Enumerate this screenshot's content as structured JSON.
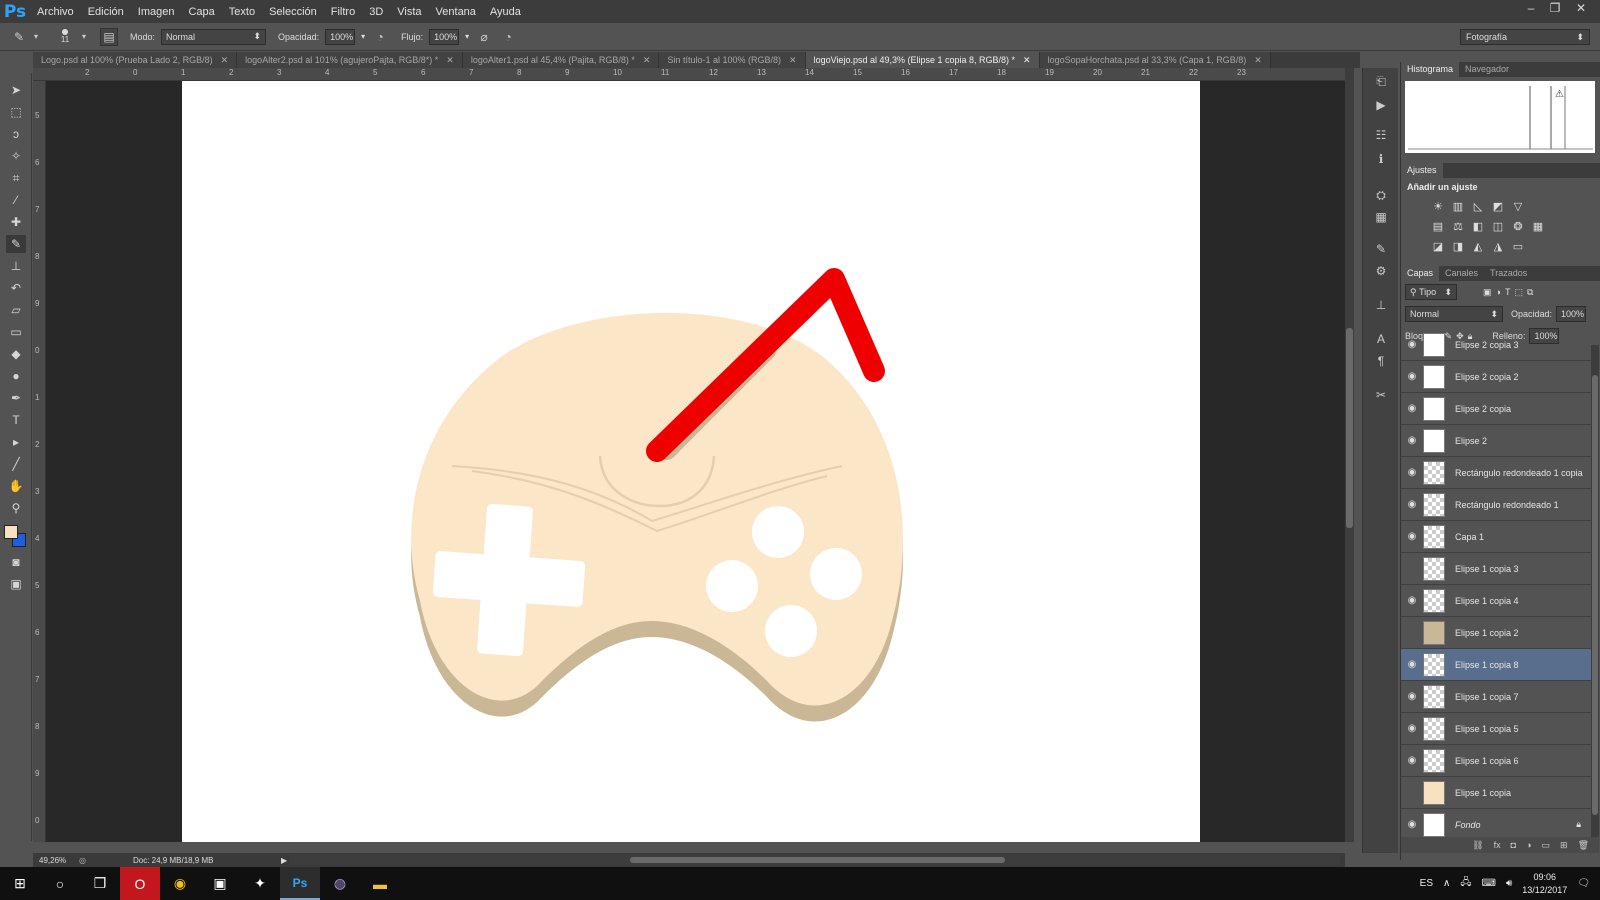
{
  "app": {
    "logo": "Ps"
  },
  "menu": [
    "Archivo",
    "Edición",
    "Imagen",
    "Capa",
    "Texto",
    "Selección",
    "Filtro",
    "3D",
    "Vista",
    "Ventana",
    "Ayuda"
  ],
  "options": {
    "brush_size": "11",
    "mode_label": "Modo:",
    "mode_value": "Normal",
    "opacity_label": "Opacidad:",
    "opacity_value": "100%",
    "flow_label": "Flujo:",
    "flow_value": "100%",
    "workspace": "Fotografía"
  },
  "tabs": [
    {
      "label": "Logo.psd al 100% (Prueba Lado 2, RGB/8)"
    },
    {
      "label": "logoAlter2.psd al 101% (agujeroPajta, RGB/8*) *"
    },
    {
      "label": "logoAlter1.psd al 45,4% (Pajita, RGB/8) *"
    },
    {
      "label": "Sin título-1 al 100% (RGB/8)"
    },
    {
      "label": "logoViejo.psd al 49,3% (Elipse 1 copia 8, RGB/8) *"
    },
    {
      "label": "logoSopaHorchata.psd al 33,3% (Capa 1, RGB/8)"
    }
  ],
  "ruler_top": [
    "2",
    "0",
    "1",
    "2",
    "3",
    "4",
    "5",
    "6",
    "7",
    "8",
    "9",
    "10",
    "11",
    "12",
    "13",
    "14",
    "15",
    "16",
    "17",
    "18",
    "19",
    "20",
    "21",
    "22",
    "23"
  ],
  "ruler_left": [
    "5",
    "6",
    "7",
    "8",
    "9",
    "0",
    "1",
    "2",
    "3",
    "4",
    "5",
    "6",
    "7",
    "8",
    "9",
    "0"
  ],
  "status": {
    "zoom": "49,26%",
    "doc": "Doc: 24,9 MB/18,9 MB"
  },
  "panels": {
    "top_tabs": [
      "Histograma",
      "Navegador"
    ],
    "adj_tab": "Ajustes",
    "adj_title": "Añadir un ajuste",
    "layer_tabs": [
      "Capas",
      "Canales",
      "Trazados"
    ],
    "filter_kind": "Tipo",
    "blend_mode": "Normal",
    "opacity_label": "Opacidad:",
    "opacity_value": "100%",
    "lock_label": "Bloq.:",
    "fill_label": "Relleno:",
    "fill_value": "100%"
  },
  "layers": [
    {
      "name": "Elipse 2 copia 3",
      "thumb": "white",
      "visible": true
    },
    {
      "name": "Elipse 2 copia 2",
      "thumb": "white",
      "visible": true
    },
    {
      "name": "Elipse 2 copia",
      "thumb": "white",
      "visible": true
    },
    {
      "name": "Elipse 2",
      "thumb": "white",
      "visible": true
    },
    {
      "name": "Rectángulo redondeado 1 copia",
      "thumb": "shape",
      "visible": true
    },
    {
      "name": "Rectángulo redondeado 1",
      "thumb": "shape",
      "visible": true
    },
    {
      "name": "Capa 1",
      "thumb": "check",
      "visible": true
    },
    {
      "name": "Elipse 1 copia 3",
      "thumb": "check",
      "visible": false
    },
    {
      "name": "Elipse 1 copia 4",
      "thumb": "check",
      "visible": true
    },
    {
      "name": "Elipse 1 copia 2",
      "thumb": "tan",
      "visible": false
    },
    {
      "name": "Elipse 1 copia 8",
      "thumb": "check",
      "visible": true,
      "selected": true
    },
    {
      "name": "Elipse 1 copia 7",
      "thumb": "check",
      "visible": true
    },
    {
      "name": "Elipse 1 copia 5",
      "thumb": "check",
      "visible": true
    },
    {
      "name": "Elipse 1 copia 6",
      "thumb": "check",
      "visible": true
    },
    {
      "name": "Elipse 1 copia",
      "thumb": "cream",
      "visible": false
    },
    {
      "name": "Fondo",
      "thumb": "white",
      "visible": true
    }
  ],
  "taskbar": {
    "lang": "ES",
    "time": "09:06",
    "date": "13/12/2017"
  },
  "colors": {
    "foreground": "#f8e1bf",
    "background": "#1c5fe0",
    "straw": "#ee0000",
    "controller": "#fbe6c8",
    "shadow": "#c9b795"
  }
}
